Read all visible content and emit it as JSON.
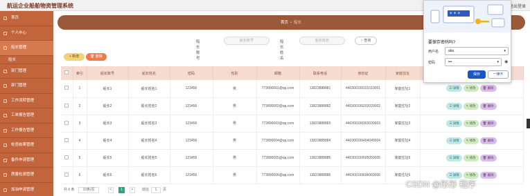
{
  "app": {
    "title": "航运企业船舶物资管理系统",
    "logout": "退出登录"
  },
  "sidebar": {
    "items": [
      {
        "label": "首页"
      },
      {
        "label": "个人中心"
      },
      {
        "label": "船长管理"
      },
      {
        "label": "船长",
        "sub": true
      },
      {
        "label": "部门管理"
      },
      {
        "label": "部门管理"
      },
      {
        "label": "工作流转管理"
      },
      {
        "label": "工单报告管理"
      },
      {
        "label": "工作报告管理"
      },
      {
        "label": "检查结果管理"
      },
      {
        "label": "备件申请管理"
      },
      {
        "label": "质量检测管理"
      },
      {
        "label": "加油申请管理"
      }
    ]
  },
  "breadcrumb": {
    "home": "首页",
    "current": "船长"
  },
  "search": {
    "label1": "船长账号",
    "placeholder1": "船长账号",
    "label2": "船长姓名",
    "placeholder2": "船长姓名",
    "button": "查询"
  },
  "toolbar": {
    "add": "新增",
    "delete": "删除"
  },
  "table": {
    "headers": [
      "索引",
      "船长账号",
      "船长姓名",
      "密码",
      "性别",
      "邮箱",
      "联系电话",
      "身份证",
      "家庭住址"
    ],
    "rows": [
      {
        "idx": "1",
        "account": "船长1",
        "name": "船长姓名1",
        "password": "123456",
        "gender": "男",
        "email": "773890001@qq.com",
        "phone": "13823888881",
        "idcard": "440300199101010001",
        "address": "家庭住址1"
      },
      {
        "idx": "2",
        "account": "船长2",
        "name": "船长姓名2",
        "password": "123456",
        "gender": "男",
        "email": "773890002@qq.com",
        "phone": "13823888882",
        "idcard": "440300199202020002",
        "address": "家庭住址2"
      },
      {
        "idx": "3",
        "account": "船长3",
        "name": "船长姓名3",
        "password": "123456",
        "gender": "男",
        "email": "773890003@qq.com",
        "phone": "13823888883",
        "idcard": "440300199303030003",
        "address": "家庭住址3"
      },
      {
        "idx": "4",
        "account": "船长4",
        "name": "船长姓名4",
        "password": "123456",
        "gender": "男",
        "email": "773890004@qq.com",
        "phone": "13823888884",
        "idcard": "440300199404040004",
        "address": "家庭住址4"
      },
      {
        "idx": "5",
        "account": "船长5",
        "name": "船长姓名5",
        "password": "123456",
        "gender": "男",
        "email": "773890005@qq.com",
        "phone": "13823888885",
        "idcard": "440300199505050005",
        "address": "家庭住址5"
      },
      {
        "idx": "6",
        "account": "船长6",
        "name": "船长姓名6",
        "password": "123456",
        "gender": "男",
        "email": "773890006@qq.com",
        "phone": "13823888886",
        "idcard": "440300199606060006",
        "address": "家庭住址6"
      }
    ],
    "actions": {
      "detail": "详情",
      "edit": "修改",
      "delete": "删除"
    }
  },
  "pager": {
    "total": "共 6 条",
    "page_size": "10条/页",
    "prev": "<",
    "page": "1",
    "next": ">",
    "goto": "前往",
    "goto_page": "1",
    "page_unit": "页"
  },
  "password_popup": {
    "title": "要保存密码吗?",
    "user_label": "用户名",
    "user_value": "abo",
    "pass_label": "密码",
    "pass_value": "•••",
    "save": "保存",
    "never": "一律不"
  },
  "watermark": "CSDN @彤彤  程序",
  "colors": {
    "sidebar": "#c2643c",
    "crumb_bar": "#9a5a3a",
    "header_row": "#f5dbd0",
    "save_button": "#1a57c4"
  }
}
